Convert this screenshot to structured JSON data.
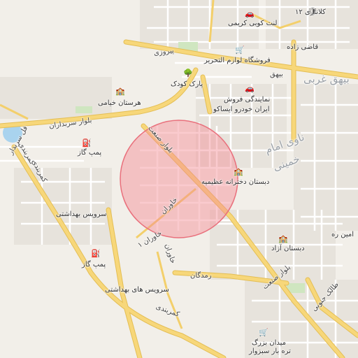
{
  "colors": {
    "background": "#f2efe9",
    "block": "#e6e2db",
    "street": "#ffffff",
    "arterial": "#f7d77a",
    "arterial_edge": "#e4be54",
    "highway": "#f3c14c",
    "green": "#cfe6c0",
    "water": "#a9d3ee",
    "circle_fill": "#f48a92",
    "circle_stroke": "#e9707c"
  },
  "search_radius_circle": {
    "fill_opacity": 0.45
  },
  "labels": {
    "kalantari12": "کلانتری ۱۲",
    "lent_kooei": "لنت کوبی کریمی",
    "ghazi_zadeh": "قاضی زاده",
    "piroozi": "پیروزی",
    "forooshgah": "فروشگاه لوازم التحریر",
    "beyhagh": "بیهق",
    "beyhagh_gharbi": "بیهق غربی",
    "park_koodak": "پارک کودک",
    "namayandegi": "نمایندگی فروش",
    "iran_khodro": "ایران خودرو ایساکو",
    "hospital": "هرستان خیامی",
    "boulevard_sarbedaran": "بلوار سربداران",
    "pump_gas_1": "پمپ گاز",
    "sanaat": "بلوار صنعت",
    "imam_khomeini_1": "ناوی امام",
    "imam_khomeini_2": "خمینی",
    "dabestan_azimieh": "دبستان دخترانه عظیمیه",
    "kamarbandi_1": "کمربندی",
    "kamarbandi_2": "کمربندی",
    "khavaran": "خاوران",
    "khavaran_1": "خاوران ۱",
    "servis_1": "سرویس بهداشتی",
    "dabestan_azad": "دبستان آزاد",
    "amin": "امین ره",
    "pump_gas_2": "پمپ گاز",
    "ramazgan": "رمدگان",
    "sanaat_2": "بلوار صنعت",
    "servis_2": "سرویس های بهداشتی",
    "tatlak": "طالک جنوبی",
    "maydan_bozorg": "میدان بزرگ",
    "tareh_bar": "تره بار سبزوار",
    "cirbadan": "فل سربدار"
  },
  "icons": {
    "car": "car-icon",
    "shop": "shop-icon",
    "tree": "park-icon",
    "school": "school-icon",
    "fuel": "fuel-icon",
    "shield": "police-icon"
  }
}
